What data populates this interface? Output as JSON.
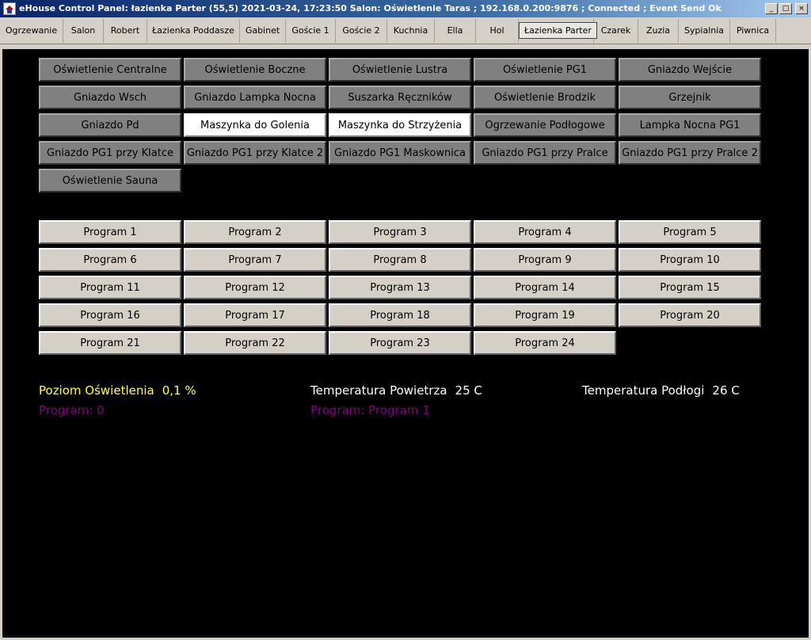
{
  "window": {
    "title": "eHouse Control Panel: łazienka Parter  (55,5) 2021-03-24, 17:23:50   Salon: Oświetlenie Taras ; 192.168.0.200:9876 ; Connected ; Event Send Ok",
    "minimize": "_",
    "maximize": "□",
    "close": "×"
  },
  "tabs": [
    {
      "label": "Ogrzewanie"
    },
    {
      "label": "Salon"
    },
    {
      "label": "Robert"
    },
    {
      "label": "Łazienka Poddasze"
    },
    {
      "label": "Gabinet"
    },
    {
      "label": "Goście 1"
    },
    {
      "label": "Goście 2"
    },
    {
      "label": "Kuchnia"
    },
    {
      "label": "Ella"
    },
    {
      "label": "Hol"
    },
    {
      "label": "Łazienka Parter",
      "active": true
    },
    {
      "label": "Czarek"
    },
    {
      "label": "Zuzia"
    },
    {
      "label": "Sypialnia"
    },
    {
      "label": "Piwnica"
    }
  ],
  "devices": [
    {
      "label": "Oświetlenie Centralne",
      "on": false
    },
    {
      "label": "Oświetlenie Boczne",
      "on": false
    },
    {
      "label": "Oświetlenie Lustra",
      "on": false
    },
    {
      "label": "Oświetlenie PG1",
      "on": false
    },
    {
      "label": "Gniazdo Wejście",
      "on": false
    },
    {
      "label": "Gniazdo Wsch",
      "on": false
    },
    {
      "label": "Gniazdo Lampka Nocna",
      "on": false
    },
    {
      "label": "Suszarka Ręczników",
      "on": false
    },
    {
      "label": "Oświetlenie Brodzik",
      "on": false
    },
    {
      "label": "Grzejnik",
      "on": false
    },
    {
      "label": "Gniazdo Pd",
      "on": false
    },
    {
      "label": "Maszynka do Golenia",
      "on": true
    },
    {
      "label": "Maszynka do Strzyżenia",
      "on": true
    },
    {
      "label": "Ogrzewanie Podłogowe",
      "on": false
    },
    {
      "label": "Lampka Nocna PG1",
      "on": false
    },
    {
      "label": "Gniazdo PG1 przy Klatce",
      "on": false
    },
    {
      "label": "Gniazdo PG1 przy Klatce 2",
      "on": false
    },
    {
      "label": "Gniazdo  PG1 Maskownica",
      "on": false
    },
    {
      "label": "Gniazdo PG1 przy Pralce",
      "on": false
    },
    {
      "label": "Gniazdo PG1 przy Pralce 2",
      "on": false
    },
    {
      "label": "Oświetlenie Sauna",
      "on": false
    }
  ],
  "programs": [
    "Program 1",
    "Program 2",
    "Program 3",
    "Program 4",
    "Program 5",
    "Program 6",
    "Program 7",
    "Program 8",
    "Program 9",
    "Program 10",
    "Program 11",
    "Program 12",
    "Program 13",
    "Program 14",
    "Program 15",
    "Program 16",
    "Program 17",
    "Program 18",
    "Program 19",
    "Program 20",
    "Program 21",
    "Program 22",
    "Program 23",
    "Program 24"
  ],
  "status": {
    "light_level": {
      "label": "Poziom Oświetlenia",
      "value": "0,1 %"
    },
    "air_temp": {
      "label": "Temperatura Powietrza",
      "value": "25 C"
    },
    "floor_temp": {
      "label": "Temperatura Podłogi",
      "value": "26 C"
    },
    "program_left": "Program: 0",
    "program_mid": "Program: Program 1"
  },
  "colors": {
    "light_level": "#ffff40",
    "temperatures": "#ffffff",
    "program": "#800080"
  }
}
